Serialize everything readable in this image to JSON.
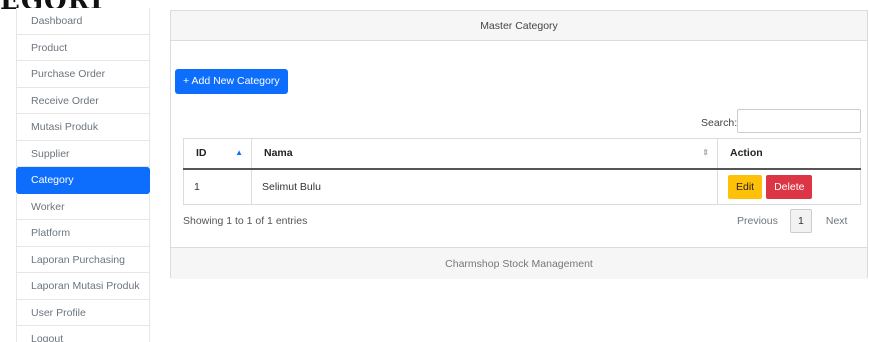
{
  "heading": "EGORI",
  "sidebar": {
    "items": [
      {
        "label": "Dashboard"
      },
      {
        "label": "Product"
      },
      {
        "label": "Purchase Order"
      },
      {
        "label": "Receive Order"
      },
      {
        "label": "Mutasi Produk"
      },
      {
        "label": "Supplier"
      },
      {
        "label": "Category",
        "active": true
      },
      {
        "label": "Worker"
      },
      {
        "label": "Platform"
      },
      {
        "label": "Laporan Purchasing"
      },
      {
        "label": "Laporan Mutasi Produk"
      },
      {
        "label": "User Profile"
      },
      {
        "label": "Logout"
      }
    ]
  },
  "card": {
    "title": "Master Category",
    "add_button": "+ Add New Category",
    "search_label": "Search:",
    "table": {
      "headers": [
        "ID",
        "Nama",
        "Action"
      ],
      "rows": [
        {
          "id": "1",
          "nama": "Selimut Bulu",
          "edit": "Edit",
          "delete": "Delete"
        }
      ]
    },
    "info": "Showing 1 to 1 of 1 entries",
    "pagination": {
      "previous": "Previous",
      "page": "1",
      "next": "Next"
    },
    "footer": "Charmshop Stock Management"
  },
  "colors": {
    "primary": "#0d6efd",
    "warning": "#ffc107",
    "danger": "#dc3545"
  }
}
